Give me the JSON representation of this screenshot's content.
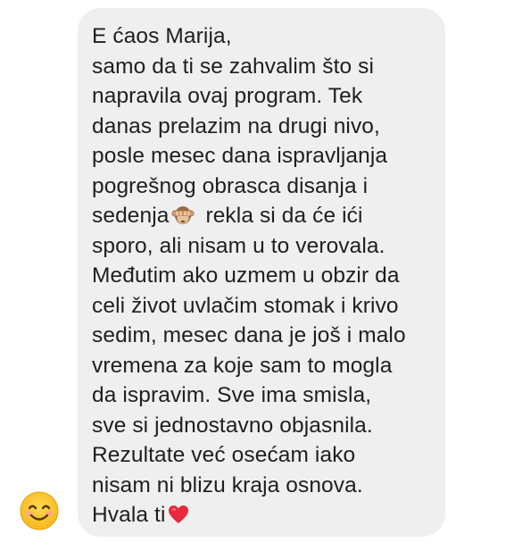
{
  "message": {
    "lines": [
      "E ćaos Marija,",
      "samo da ti se zahvalim što si",
      "napravila ovaj program. Tek",
      "danas prelazim na drugi nivo,",
      "posle mesec dana ispravljanja",
      "pogrešnog obrasca disanja i",
      "sedenja",
      " rekla si da će ići",
      "sporo, ali nisam  u to verovala.",
      "Međutim ako uzmem u obzir da",
      "celi život uvlačim stomak i krivo",
      "sedim, mesec dana je još i malo",
      "vremena za koje sam to mogla",
      "da ispravim. Sve ima smisla,",
      "sve si jednostavno objasnila.",
      "Rezultate već osećam iako",
      "nisam ni blizu kraja osnova.",
      "Hvala ti"
    ],
    "inline_emojis": [
      "see-no-evil-monkey-icon",
      "red-heart-icon"
    ]
  },
  "sender": {
    "avatar_icon": "smiling-face-icon"
  },
  "colors": {
    "bubble_bg": "#efefef",
    "text": "#1f1f1f",
    "heart": "#e8283c",
    "avatar_face": "#fcc21b"
  }
}
